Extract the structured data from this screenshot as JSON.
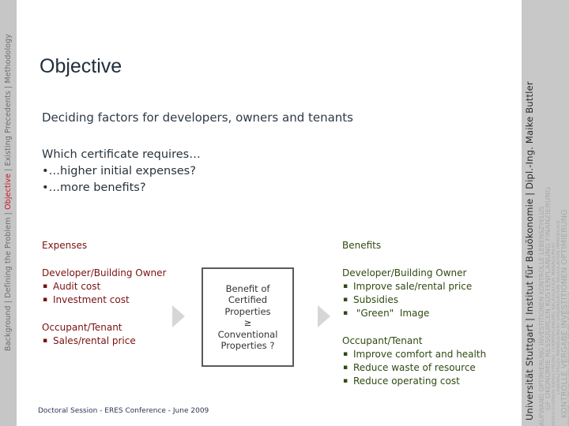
{
  "nav": {
    "items": [
      "Background",
      "Defining the Problem",
      "Objective",
      "Existing Precedents",
      "Methodology"
    ],
    "active": "Objective",
    "separator": " | "
  },
  "credit": "Universität Stuttgart  |  Institut für Bauökonomie  |  Dipl.-Ing. Maike Buttler",
  "watermark_words": [
    "AUFWAND OPTIMIERUNG INVESTITIONEN KONTROLLE LEBENSZYKLUS",
    "GF ÖKONOMIE RESSOURCEN KOSTENPLANUNG FINANZIERUNG",
    "INVESTITIONEN ABRECHNUNG TERMINPLANUNG KALKULATION MANAGEMENT",
    "LEBENSZYKLUS MANAGEMENT ORGANISATION KALKULATION IMMOBILIEN",
    "KONTROLLE VERGABE INVESTITIONEN OPTIMIERUNG",
    "VERGABE CONTROLLING ENERGIEPLANUNG KONTROLLE"
  ],
  "slide": {
    "title": "Objective",
    "subtitle": "Deciding factors for developers, owners and tenants",
    "question": {
      "lead": "Which certificate requires…",
      "items": [
        "•…higher initial expenses?",
        "•…more benefits?"
      ]
    },
    "expenses": {
      "heading": "Expenses",
      "groups": [
        {
          "title": "Developer/Building Owner",
          "items": [
            "Audit cost",
            "Investment cost"
          ]
        },
        {
          "title": "Occupant/Tenant",
          "items": [
            "Sales/rental price"
          ]
        }
      ]
    },
    "center_box": {
      "lines": [
        "Benefit of",
        "Certified",
        "Properties",
        "≥",
        "Conventional",
        "Properties ?"
      ]
    },
    "benefits": {
      "heading": "Benefits",
      "groups": [
        {
          "title": "Developer/Building Owner",
          "items": [
            "Improve sale/rental price",
            "Subsidies",
            " \"Green\"  Image"
          ]
        },
        {
          "title": "Occupant/Tenant",
          "items": [
            "Improve comfort and health",
            "Reduce waste of resource",
            "Reduce operating cost"
          ]
        }
      ]
    },
    "footer": "Doctoral Session - ERES Conference - June 2009"
  },
  "colors": {
    "expenses": "#7a1010",
    "benefits": "#2f4a12",
    "nav_active": "#c0141c",
    "band": "#c6c6c6"
  }
}
